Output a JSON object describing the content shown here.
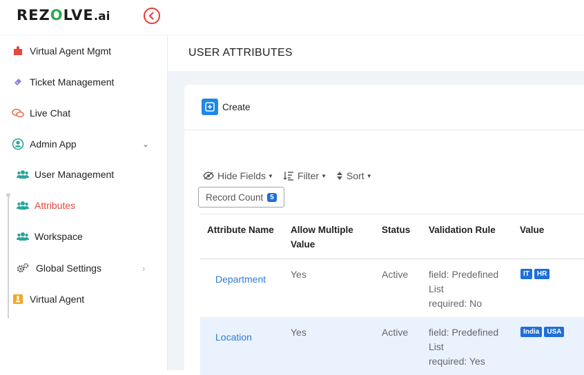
{
  "brand": {
    "logo_pre": "REZ",
    "logo_o": "O",
    "logo_post": "LVE",
    "logo_ai": ".ai"
  },
  "sidebar": {
    "items": [
      {
        "label": "Virtual Agent Mgmt",
        "icon": "puzzle-icon"
      },
      {
        "label": "Ticket Management",
        "icon": "ticket-icon"
      },
      {
        "label": "Live Chat",
        "icon": "chat-icon"
      },
      {
        "label": "Admin App",
        "icon": "user-circle-icon"
      },
      {
        "label": "User Management",
        "icon": "users-icon"
      },
      {
        "label": "Attributes",
        "icon": "users-icon",
        "active": true
      },
      {
        "label": "Workspace",
        "icon": "users-icon"
      },
      {
        "label": "Global Settings",
        "icon": "gears-icon"
      },
      {
        "label": "Virtual Agent",
        "icon": "agent-icon"
      }
    ]
  },
  "page": {
    "title": "USER ATTRIBUTES"
  },
  "toolbar": {
    "create_label": "Create",
    "hide_fields_label": "Hide Fields",
    "filter_label": "Filter",
    "sort_label": "Sort",
    "record_count_label": "Record Count",
    "record_count": "5"
  },
  "table": {
    "headers": {
      "name": "Attribute Name",
      "multi_1": "Allow Multiple",
      "multi_2": "Value",
      "status": "Status",
      "validation": "Validation Rule",
      "value": "Value"
    },
    "rows": [
      {
        "name": "Department",
        "multi": "Yes",
        "status": "Active",
        "rule_1": "field: Predefined",
        "rule_2": "List",
        "rule_3": "required: No",
        "tags": [
          "IT",
          "HR"
        ]
      },
      {
        "name": "Location",
        "multi": "Yes",
        "status": "Active",
        "rule_1": "field: Predefined",
        "rule_2": "List",
        "rule_3": "required: Yes",
        "tags": [
          "India",
          "USA"
        ]
      }
    ]
  },
  "colors": {
    "accent": "#1e88e5",
    "active": "#e5483d",
    "link": "#2f7ad4",
    "row_alt": "#eaf2fd"
  }
}
